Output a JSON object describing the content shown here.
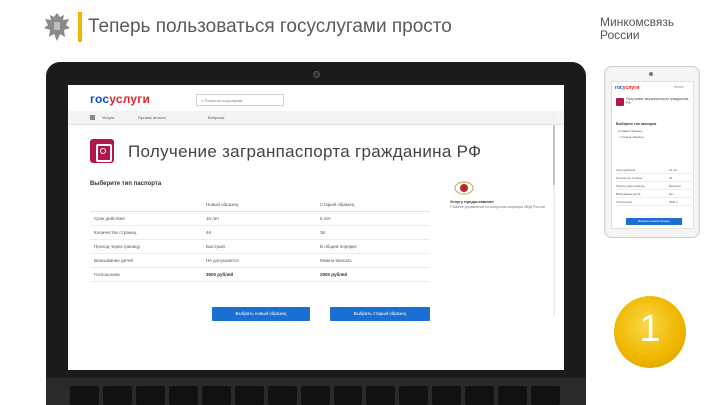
{
  "slide": {
    "title": "Теперь пользоваться госуслугами просто",
    "ministry_line1": "Минкомсвязь",
    "ministry_line2": "России",
    "step_number": "1"
  },
  "site": {
    "logo_gos": "гос",
    "logo_uslugi": "услуги",
    "search_placeholder": "Поиск по госуслугам",
    "nav_items": [
      "Услуги",
      "Органы власти",
      "Вопросы"
    ],
    "page_title": "Получение загранпаспорта гражданина РФ",
    "choose_label": "Выберите тип паспорта",
    "table": {
      "headers": [
        "",
        "Новый образец",
        "Старый образец"
      ],
      "rows": [
        [
          "Срок действия",
          "10 лет",
          "5 лет"
        ],
        [
          "Количество страниц",
          "46",
          "36"
        ],
        [
          "Проход через границу",
          "Быстрый",
          "В общем порядке"
        ],
        [
          "Вписывание детей",
          "Не допускается",
          "Можно вписать"
        ],
        [
          "Госпошлина",
          "3500 рублей",
          "2000 рублей"
        ]
      ]
    },
    "btn_new": "Выбрать новый образец",
    "btn_old": "Выбрать старый образец",
    "provider_label": "Услугу предоставляет",
    "provider_org": "Главное управление по вопросам миграции МВД России"
  },
  "phone": {
    "logo_gos": "гос",
    "logo_uslugi": "услуги",
    "menu": "Меню",
    "title": "Получение загранпаспорта гражданина РФ",
    "choose": "Выберите тип паспорта",
    "opt_new": "Новый образец",
    "opt_old": "Старый образец",
    "rows": [
      [
        "Срок действия",
        "10 лет"
      ],
      [
        "Количество страниц",
        "46"
      ],
      [
        "Проход через границу",
        "Быстрый"
      ],
      [
        "Вписывание детей",
        "Нет"
      ],
      [
        "Госпошлина",
        "3500 р."
      ]
    ],
    "btn": "Выбрать новый образец"
  },
  "colors": {
    "accent_yellow": "#f0b400",
    "brand_blue": "#0d4cd3",
    "brand_red": "#e6232a",
    "button_blue": "#1a6fd3",
    "service_icon": "#b2164a"
  }
}
